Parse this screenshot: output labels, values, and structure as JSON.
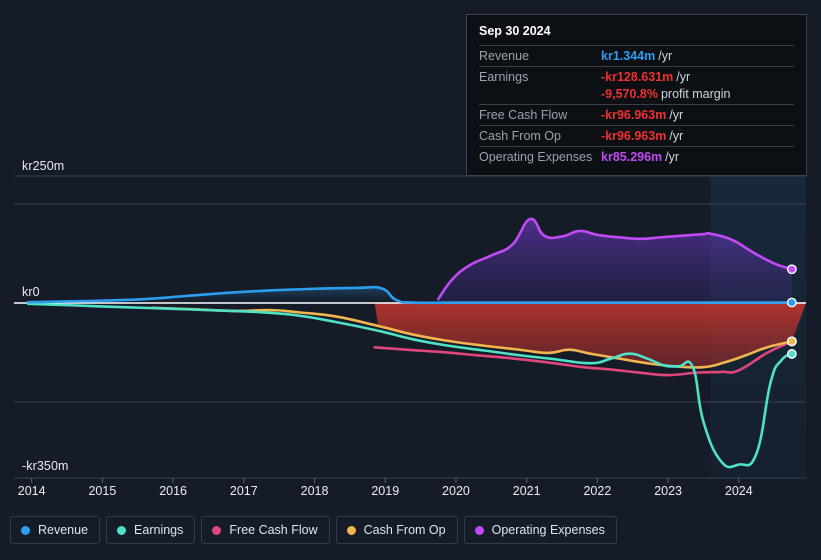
{
  "chart_data": {
    "type": "area",
    "title": "",
    "xlabel": "",
    "ylabel": "",
    "currency_prefix": "kr",
    "ylim": [
      -350,
      250
    ],
    "y_ticks": [
      {
        "label": "kr250m",
        "value": 250
      },
      {
        "label": "kr0",
        "value": 0
      },
      {
        "label": "-kr350m",
        "value": -350
      }
    ],
    "grid": true,
    "legend_position": "bottom",
    "x_ticks": [
      "2014",
      "2015",
      "2016",
      "2017",
      "2018",
      "2019",
      "2020",
      "2021",
      "2022",
      "2023",
      "2024"
    ],
    "x_range": [
      2013.75,
      2024.95
    ],
    "forecast_boundary": "2023.6",
    "series": [
      {
        "name": "Revenue",
        "color": "#2c9ef0",
        "points": [
          [
            2013.95,
            2
          ],
          [
            2014.5,
            4
          ],
          [
            2015.0,
            6
          ],
          [
            2015.6,
            10
          ],
          [
            2016.2,
            18
          ],
          [
            2016.8,
            26
          ],
          [
            2017.4,
            32
          ],
          [
            2018.0,
            36
          ],
          [
            2018.6,
            38
          ],
          [
            2018.95,
            37
          ],
          [
            2019.15,
            8
          ],
          [
            2019.4,
            1
          ],
          [
            2020.0,
            1
          ],
          [
            2021.0,
            1
          ],
          [
            2022.0,
            1
          ],
          [
            2023.0,
            1
          ],
          [
            2023.6,
            1
          ],
          [
            2024.0,
            1
          ],
          [
            2024.75,
            1.344
          ]
        ]
      },
      {
        "name": "Earnings",
        "color": "#4fe0c8",
        "points": [
          [
            2013.95,
            -2
          ],
          [
            2014.6,
            -6
          ],
          [
            2015.2,
            -10
          ],
          [
            2015.9,
            -14
          ],
          [
            2016.5,
            -18
          ],
          [
            2017.1,
            -22
          ],
          [
            2017.7,
            -30
          ],
          [
            2018.3,
            -48
          ],
          [
            2018.9,
            -70
          ],
          [
            2019.4,
            -92
          ],
          [
            2019.9,
            -108
          ],
          [
            2020.4,
            -120
          ],
          [
            2020.9,
            -132
          ],
          [
            2021.4,
            -142
          ],
          [
            2021.9,
            -152
          ],
          [
            2022.2,
            -140
          ],
          [
            2022.45,
            -128
          ],
          [
            2022.7,
            -140
          ],
          [
            2022.95,
            -158
          ],
          [
            2023.15,
            -160
          ],
          [
            2023.35,
            -162
          ],
          [
            2023.5,
            -300
          ],
          [
            2023.75,
            -400
          ],
          [
            2024.0,
            -408
          ],
          [
            2024.25,
            -380
          ],
          [
            2024.45,
            -200
          ],
          [
            2024.6,
            -145
          ],
          [
            2024.75,
            -128.631
          ]
        ]
      },
      {
        "name": "Free Cash Flow",
        "color": "#e0457b",
        "points": [
          [
            2018.85,
            -112
          ],
          [
            2019.3,
            -118
          ],
          [
            2019.8,
            -124
          ],
          [
            2020.3,
            -132
          ],
          [
            2020.8,
            -140
          ],
          [
            2021.3,
            -150
          ],
          [
            2021.8,
            -162
          ],
          [
            2022.2,
            -168
          ],
          [
            2022.6,
            -176
          ],
          [
            2023.0,
            -182
          ],
          [
            2023.4,
            -176
          ],
          [
            2023.75,
            -174
          ],
          [
            2024.0,
            -170
          ],
          [
            2024.4,
            -126
          ],
          [
            2024.75,
            -96.963
          ]
        ]
      },
      {
        "name": "Cash From Op",
        "color": "#f0b450",
        "points": [
          [
            2015.7,
            -12
          ],
          [
            2016.3,
            -16
          ],
          [
            2016.9,
            -20
          ],
          [
            2017.4,
            -18
          ],
          [
            2017.8,
            -24
          ],
          [
            2018.3,
            -34
          ],
          [
            2018.9,
            -58
          ],
          [
            2019.4,
            -80
          ],
          [
            2019.9,
            -96
          ],
          [
            2020.4,
            -108
          ],
          [
            2020.9,
            -118
          ],
          [
            2021.3,
            -126
          ],
          [
            2021.6,
            -118
          ],
          [
            2021.9,
            -128
          ],
          [
            2022.3,
            -140
          ],
          [
            2022.7,
            -152
          ],
          [
            2023.1,
            -160
          ],
          [
            2023.5,
            -162
          ],
          [
            2023.8,
            -150
          ],
          [
            2024.1,
            -132
          ],
          [
            2024.4,
            -112
          ],
          [
            2024.75,
            -96.963
          ]
        ]
      },
      {
        "name": "Operating Expenses",
        "color": "#c04bf5",
        "points": [
          [
            2019.75,
            10
          ],
          [
            2019.95,
            60
          ],
          [
            2020.2,
            96
          ],
          [
            2020.5,
            120
          ],
          [
            2020.8,
            148
          ],
          [
            2021.05,
            212
          ],
          [
            2021.25,
            170
          ],
          [
            2021.5,
            168
          ],
          [
            2021.75,
            182
          ],
          [
            2022.0,
            172
          ],
          [
            2022.3,
            166
          ],
          [
            2022.6,
            162
          ],
          [
            2022.9,
            166
          ],
          [
            2023.2,
            170
          ],
          [
            2023.5,
            174
          ],
          [
            2023.6,
            175
          ],
          [
            2023.9,
            160
          ],
          [
            2024.2,
            128
          ],
          [
            2024.5,
            100
          ],
          [
            2024.75,
            85.296
          ]
        ]
      }
    ]
  },
  "tooltip": {
    "date": "Sep 30 2024",
    "rows": [
      {
        "key": "Revenue",
        "value": "kr1.344m",
        "unit": "/yr",
        "color_class": "v-blue"
      },
      {
        "key": "Earnings",
        "value": "-kr128.631m",
        "unit": "/yr",
        "color_class": "v-red"
      },
      {
        "key": "",
        "value": "-9,570.8%",
        "unit": "profit margin",
        "color_class": "v-red"
      },
      {
        "key": "Free Cash Flow",
        "value": "-kr96.963m",
        "unit": "/yr",
        "color_class": "v-red"
      },
      {
        "key": "Cash From Op",
        "value": "-kr96.963m",
        "unit": "/yr",
        "color_class": "v-red"
      },
      {
        "key": "Operating Expenses",
        "value": "kr85.296m",
        "unit": "/yr",
        "color_class": "v-purple"
      }
    ]
  },
  "legend": {
    "items": [
      {
        "label": "Revenue",
        "color": "#2c9ef0"
      },
      {
        "label": "Earnings",
        "color": "#4fe0c8"
      },
      {
        "label": "Free Cash Flow",
        "color": "#e0457b"
      },
      {
        "label": "Cash From Op",
        "color": "#f0b450"
      },
      {
        "label": "Operating Expenses",
        "color": "#c04bf5"
      }
    ]
  }
}
